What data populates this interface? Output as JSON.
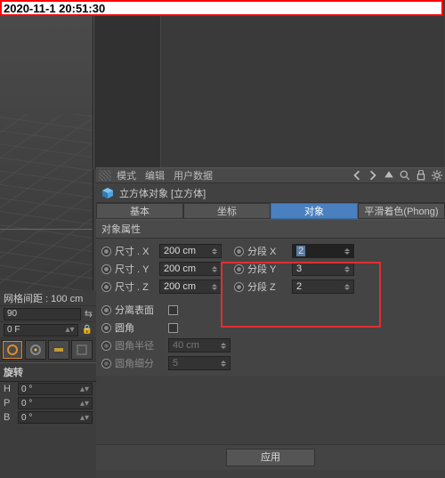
{
  "timestamp": "2020-11-1 20:51:30",
  "left": {
    "grid_label": "网格间距 : 100 cm",
    "secondary_value": "0 F",
    "thumb_value": "90",
    "rotation_header": "旋转",
    "axes": {
      "H": "H",
      "P": "P",
      "B": "B"
    },
    "deg": "0 °"
  },
  "toolbar": {
    "mode": "模式",
    "edit": "编辑",
    "userdata": "用户数据"
  },
  "object": {
    "title": "立方体对象 [立方体]"
  },
  "tabs": {
    "basic": "基本",
    "coord": "坐标",
    "object": "对象",
    "phong": "平滑着色(Phong)"
  },
  "group_label": "对象属性",
  "props": {
    "size_x": {
      "label": "尺寸 . X",
      "value": "200 cm"
    },
    "size_y": {
      "label": "尺寸 . Y",
      "value": "200 cm"
    },
    "size_z": {
      "label": "尺寸 . Z",
      "value": "200 cm"
    },
    "seg_x": {
      "label": "分段 X",
      "value": "2"
    },
    "seg_y": {
      "label": "分段 Y",
      "value": "3"
    },
    "seg_z": {
      "label": "分段 Z",
      "value": "2"
    },
    "separate": "分离表面",
    "fillet": "圆角",
    "fillet_radius": {
      "label": "圆角半径",
      "value": "40 cm"
    },
    "fillet_sub": {
      "label": "圆角细分",
      "value": "5"
    }
  },
  "apply_label": "应用"
}
